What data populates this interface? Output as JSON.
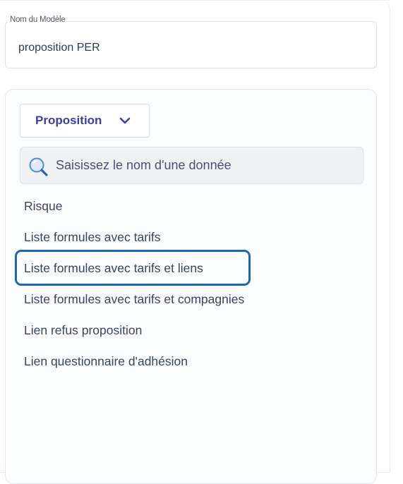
{
  "model": {
    "label": "Nom du Modèle",
    "value": "proposition PER"
  },
  "category_dropdown": {
    "label": "Proposition",
    "icon": "chevron-down-icon",
    "accent": "#3c3fa0"
  },
  "search": {
    "placeholder": "Saisissez le nom d'une donnée",
    "icon": "search-icon"
  },
  "items": [
    {
      "label": "Risque"
    },
    {
      "label": "Liste formules avec tarifs"
    },
    {
      "label": "Liste formules avec tarifs et liens",
      "highlighted": true
    },
    {
      "label": "Liste formules avec tarifs et compagnies"
    },
    {
      "label": "Lien refus proposition"
    },
    {
      "label": "Lien questionnaire d'adhésion"
    }
  ],
  "colors": {
    "highlight_border": "#1e6aa8",
    "text": "#3a4268"
  }
}
